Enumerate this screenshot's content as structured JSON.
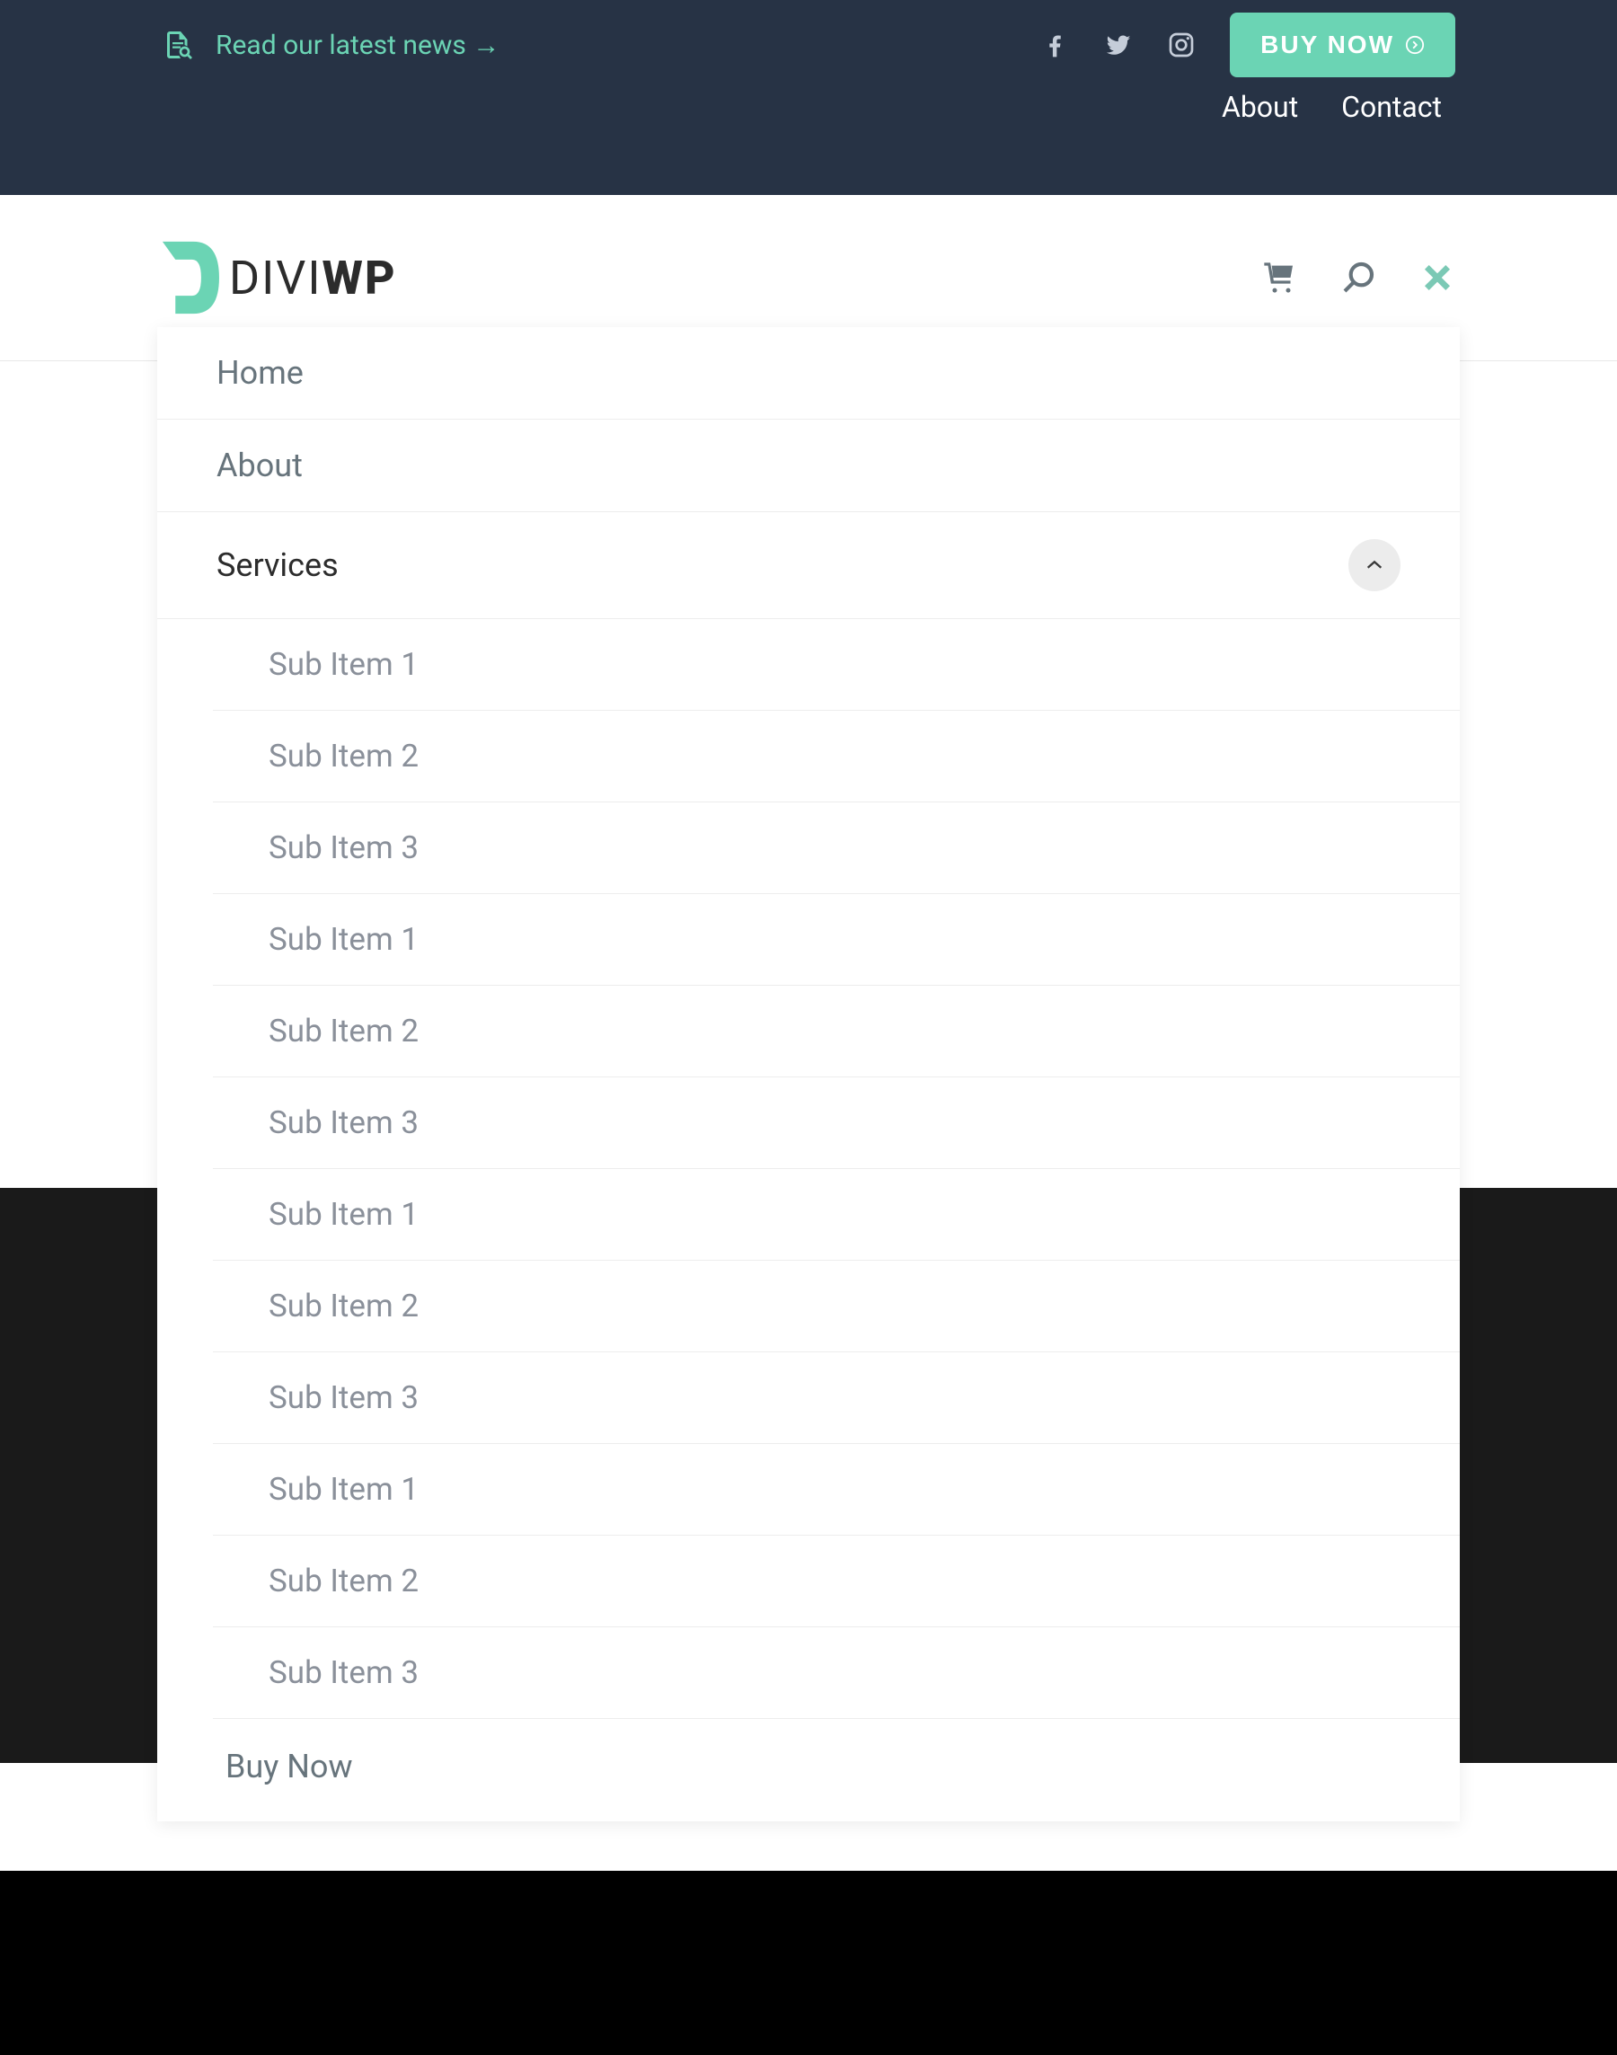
{
  "top_bar": {
    "news_link": "Read our latest news →",
    "buy_now_label": "BUY NOW",
    "nav_links": [
      "About",
      "Contact"
    ]
  },
  "logo": {
    "text_light": "DIVI",
    "text_bold": "WP"
  },
  "menu": {
    "items": [
      {
        "label": "Home",
        "active": false
      },
      {
        "label": "About",
        "active": false
      },
      {
        "label": "Services",
        "active": true
      }
    ],
    "sub_items": [
      "Sub Item 1",
      "Sub Item 2",
      "Sub Item 3",
      "Sub Item 1",
      "Sub Item 2",
      "Sub Item 3",
      "Sub Item 1",
      "Sub Item 2",
      "Sub Item 3",
      "Sub Item 1",
      "Sub Item 2",
      "Sub Item 3"
    ],
    "buy_now_label": "Buy Now"
  },
  "colors": {
    "accent": "#6bd4b4",
    "dark_bg": "#273345",
    "text_muted": "#67747c"
  }
}
